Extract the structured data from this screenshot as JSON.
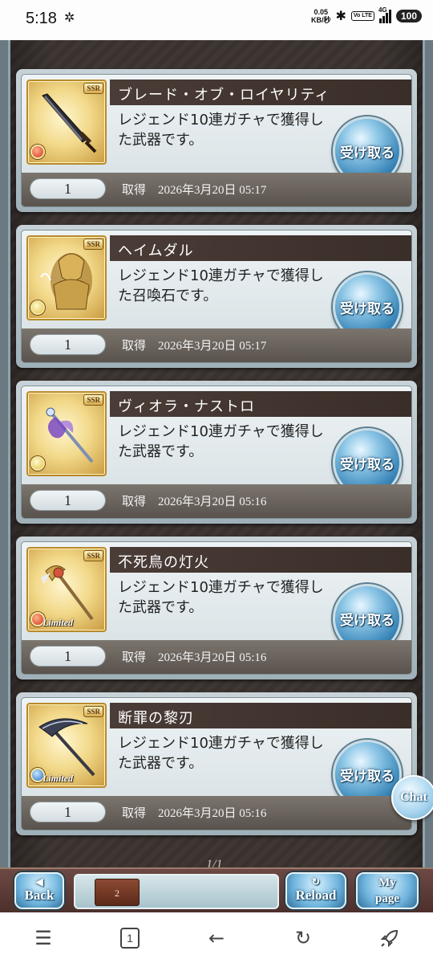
{
  "status_bar": {
    "time": "5:18",
    "net_speed_value": "0.05",
    "net_speed_unit": "KB/秒",
    "volte_label": "Vo LTE",
    "network_label": "4G",
    "battery": "100",
    "icons": [
      "gear-icon",
      "bluetooth-icon",
      "signal-icon",
      "battery-icon"
    ]
  },
  "acquired_label": "取得",
  "claim_label": "受け取る",
  "items": [
    {
      "name": "ブレード・オブ・ロイヤリティ",
      "description": "レジェンド10連ガチャで獲得した武器です。",
      "quantity": "1",
      "date": "2026年3月20日 05:17",
      "rarity": "SSR",
      "element": "fire",
      "limited": ""
    },
    {
      "name": "ヘイムダル",
      "description": "レジェンド10連ガチャで獲得した召喚石です。",
      "quantity": "1",
      "date": "2026年3月20日 05:17",
      "rarity": "SSR",
      "element": "light",
      "limited": ""
    },
    {
      "name": "ヴィオラ・ナストロ",
      "description": "レジェンド10連ガチャで獲得した武器です。",
      "quantity": "1",
      "date": "2026年3月20日 05:16",
      "rarity": "SSR",
      "element": "light",
      "limited": ""
    },
    {
      "name": "不死鳥の灯火",
      "description": "レジェンド10連ガチャで獲得した武器です。",
      "quantity": "1",
      "date": "2026年3月20日 05:16",
      "rarity": "SSR",
      "element": "fire",
      "limited": "Limited"
    },
    {
      "name": "断罪の黎刃",
      "description": "レジェンド10連ガチャで獲得した武器です。",
      "quantity": "1",
      "date": "2026年3月20日 05:16",
      "rarity": "SSR",
      "element": "water",
      "limited": "Limited"
    }
  ],
  "pager": "1/1",
  "chat_label": "Chat",
  "game_bar": {
    "back_label": "Back",
    "reload_label": "Reload",
    "mypage_label_1": "My",
    "mypage_label_2": "page",
    "stamp_text": "2"
  },
  "nav_bar": {
    "tab_count": "1",
    "icons": [
      "menu-icon",
      "tabs-icon",
      "back-arrow-icon",
      "reload-icon",
      "rocket-icon"
    ]
  }
}
